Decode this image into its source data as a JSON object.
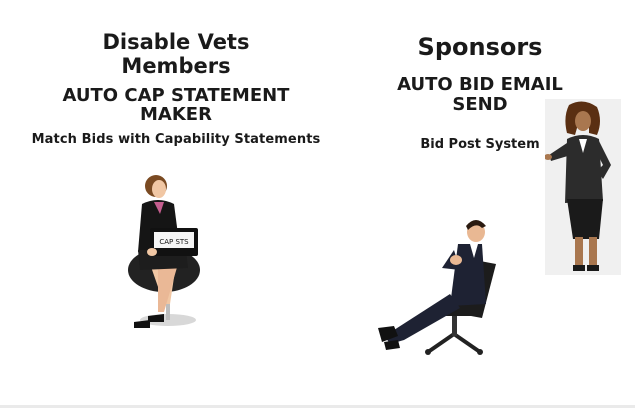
{
  "left": {
    "title_line1": "Disable Vets",
    "title_line2": "Members",
    "subtitle_line1": "AUTO CAP STATEMENT",
    "subtitle_line2": "MAKER",
    "tagline": "Match Bids with Capability Statements",
    "laptop_label": "CAP STS"
  },
  "right": {
    "title": "Sponsors",
    "subtitle_line1": "AUTO BID EMAIL",
    "subtitle_line2": "SEND",
    "tagline": "Bid Post System"
  }
}
